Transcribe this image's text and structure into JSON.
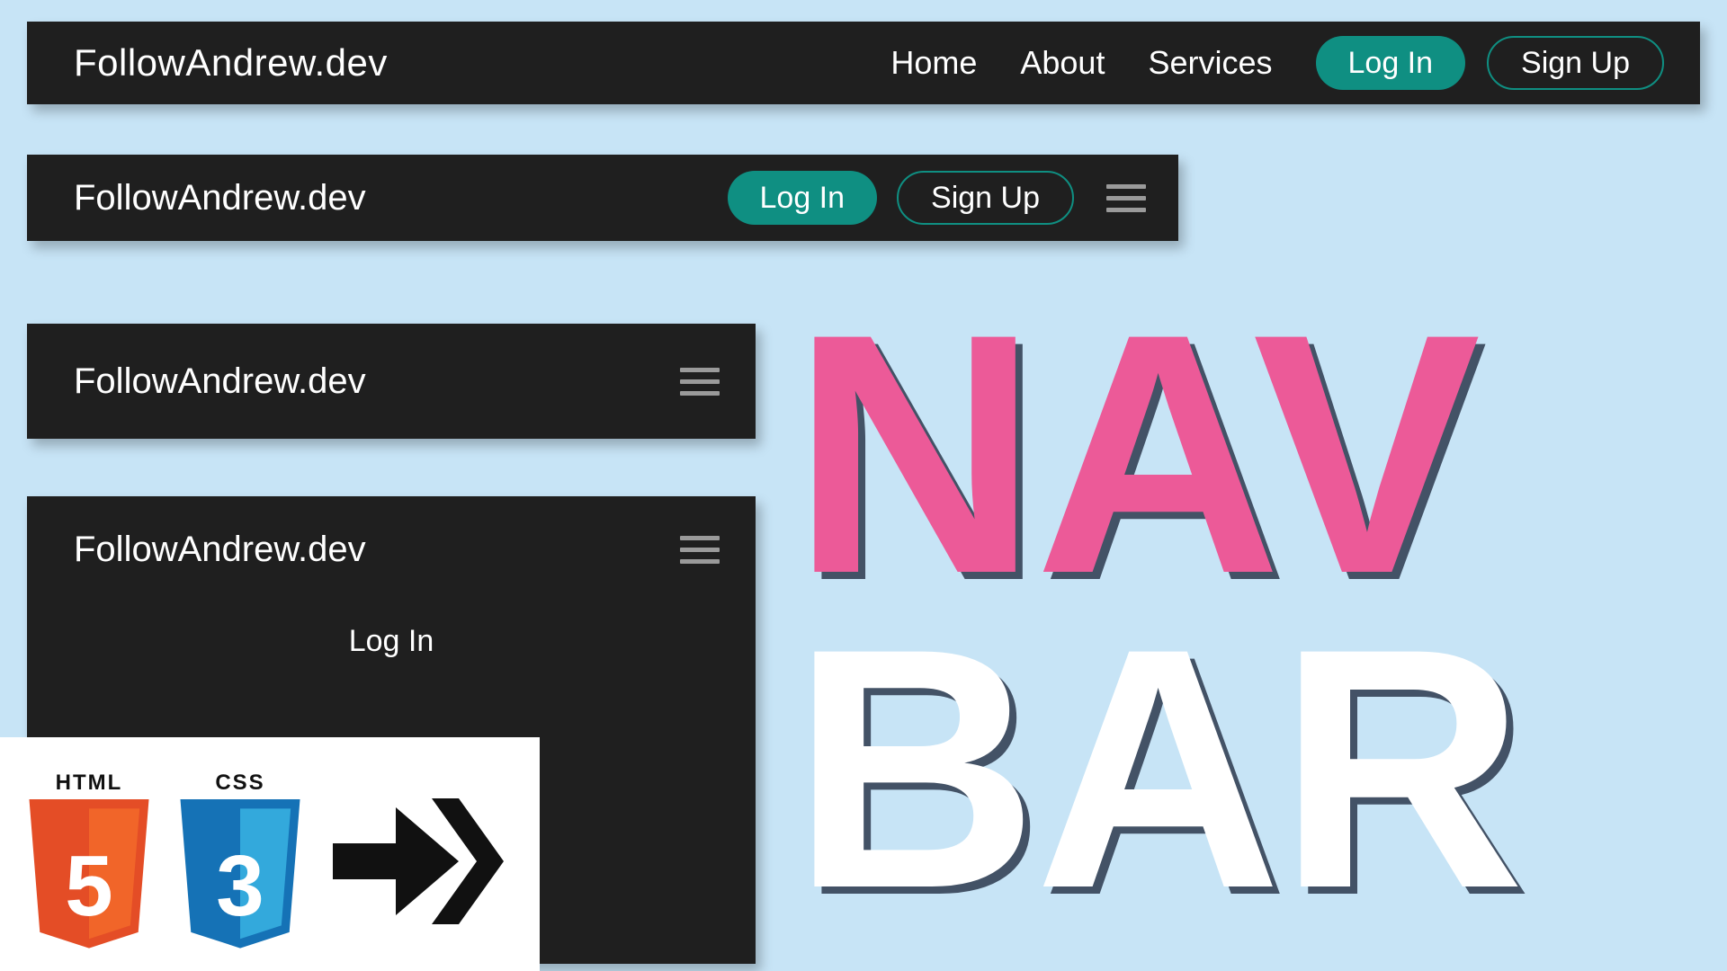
{
  "brand": "FollowAndrew.dev",
  "nav": {
    "links": [
      "Home",
      "About",
      "Services"
    ],
    "login_label": "Log In",
    "signup_label": "Sign Up"
  },
  "mobile_menu": {
    "login_label": "Log In"
  },
  "title": {
    "line1": "NAV",
    "line2": "BAR"
  },
  "badges": {
    "html_label": "HTML",
    "html_num": "5",
    "css_label": "CSS",
    "css_num": "3"
  },
  "colors": {
    "accent": "#0f8f82",
    "pink": "#ec5a98",
    "html_shield": "#e44d26",
    "css_shield": "#1572b6"
  }
}
